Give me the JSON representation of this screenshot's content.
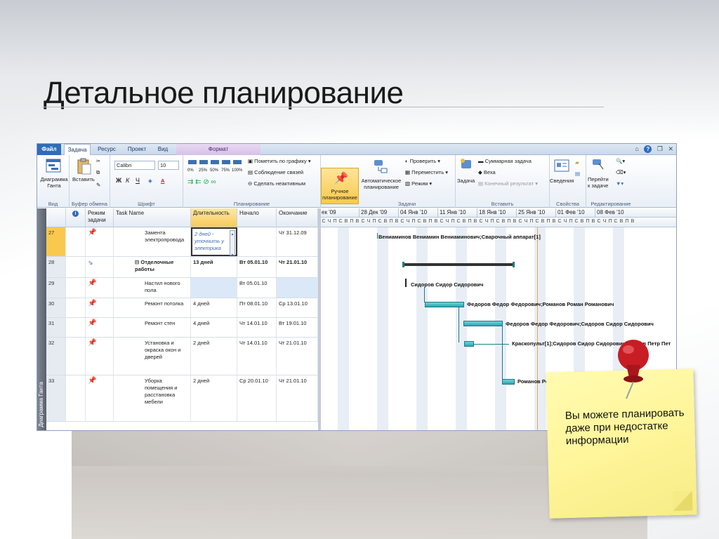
{
  "slide": {
    "title": "Детальное планирование"
  },
  "app": {
    "menu": {
      "file": "Файл",
      "tabs": [
        "Задача",
        "Ресурс",
        "Проект",
        "Вид"
      ],
      "context_tab": "Формат"
    },
    "ribbon": {
      "gantt_button": "Диаграмма\nГанта",
      "paste": "Вставить",
      "font_name": "Calibri",
      "font_size": "10",
      "mark_on_track": "Пометить по графику",
      "respect_links": "Соблюдение связей",
      "inactivate": "Сделать неактивным",
      "manual_schedule": "Ручное\nпланирование",
      "auto_schedule": "Автоматическое\nпланирование",
      "inspect": "Проверить",
      "move": "Переместить",
      "mode": "Режим",
      "task": "Задача",
      "summary_task": "Суммарная задача",
      "milestone": "Веха",
      "deliverable": "Конечный результат",
      "information": "Сведения",
      "scroll_to_task": "Перейти\nк задаче",
      "groups": [
        "Вид",
        "Буфер обмена",
        "Шрифт",
        "Планирование",
        "Задачи",
        "Вставить",
        "Свойства",
        "Редактирование"
      ],
      "pct_labels": [
        "0%",
        "25%",
        "50%",
        "75%",
        "100%"
      ]
    },
    "grid": {
      "headers": {
        "mode": "Режим\nзадачи",
        "name": "Task Name",
        "duration": "Длительность",
        "start": "Начало",
        "finish": "Окончание"
      },
      "side_label": "Диаграмма Ганта",
      "rows": [
        {
          "id": "27",
          "name": "Замента электропровода",
          "duration": "2 дней - уточнить у электрика",
          "start": "",
          "finish": "Чт 31.12.09"
        },
        {
          "id": "28",
          "name": "Отделочные работы",
          "duration": "13 дней",
          "start": "Вт 05.01.10",
          "finish": "Чт 21.01.10"
        },
        {
          "id": "29",
          "name": "Настил нового пола",
          "duration": "",
          "start": "Вт 05.01.10",
          "finish": ""
        },
        {
          "id": "30",
          "name": "Ремонт потолка",
          "duration": "4 дней",
          "start": "Пт 08.01.10",
          "finish": "Ср 13.01.10"
        },
        {
          "id": "31",
          "name": "Ремонт стен",
          "duration": "4 дней",
          "start": "Чт 14.01.10",
          "finish": "Вт 19.01.10"
        },
        {
          "id": "32",
          "name": "Установка и окраска окон и дверей",
          "duration": "2 дней",
          "start": "Чт 14.01.10",
          "finish": "Чт 21.01.10"
        },
        {
          "id": "33",
          "name": "Уборка помещения и расстановка мебели",
          "duration": "2 дней",
          "start": "Ср 20.01.10",
          "finish": "Чт 21.01.10"
        }
      ]
    },
    "gantt": {
      "weeks": [
        "ек '09",
        "28 Дек '09",
        "04 Янв '10",
        "11 Янв '10",
        "18 Янв '10",
        "25 Янв '10",
        "01 Фев '10",
        "08 Фев '10"
      ],
      "day_letters": "СЧПСВПВСЧПСВПВСЧПСВПВСЧПСВПВСЧПСВПВСЧПСВПВСЧПСВПВСЧПСВПВ",
      "labels": {
        "r27": "Вениаминов Вениамин Вениаминович;Сварочный аппарат[1]",
        "r29": "Сидоров Сидор Сидорович",
        "r30": "Федоров Федор Федорович;Романов Роман Романович",
        "r31": "Федоров Федор Федорович;Сидоров Сидор Сидорович",
        "r32": "Краскопульт[1];Сидоров Сидор Сидорович;Петров Петр Пет",
        "r33": "Романов Рома"
      }
    }
  },
  "note": {
    "text": "Вы можете планировать даже при недостатке информации"
  },
  "colors": {
    "accent": "#2f6db7",
    "bar": "#2ba6b1",
    "note": "#fff59a",
    "pin": "#d8232a"
  }
}
